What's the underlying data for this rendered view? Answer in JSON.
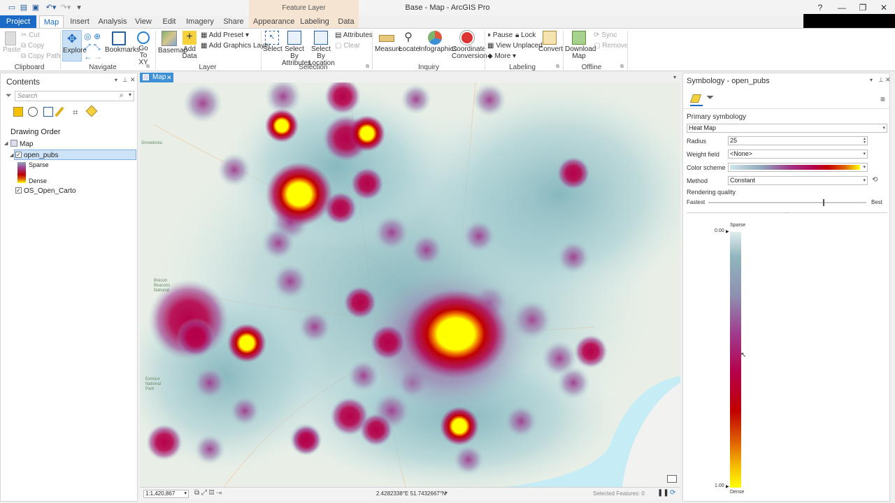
{
  "window": {
    "title": "Base - Map - ArcGIS Pro"
  },
  "context_tab": {
    "label": "Feature Layer"
  },
  "tabs": [
    {
      "label": "Project"
    },
    {
      "label": "Map"
    },
    {
      "label": "Insert"
    },
    {
      "label": "Analysis"
    },
    {
      "label": "View"
    },
    {
      "label": "Edit"
    },
    {
      "label": "Imagery"
    },
    {
      "label": "Share"
    },
    {
      "label": "Appearance"
    },
    {
      "label": "Labeling"
    },
    {
      "label": "Data"
    }
  ],
  "ribbon": {
    "clipboard": {
      "paste": "Paste",
      "cut": "Cut",
      "copy": "Copy",
      "copy_path": "Copy Path",
      "group": "Clipboard"
    },
    "navigate": {
      "explore": "Explore",
      "bookmarks": "Bookmarks",
      "goto": "Go",
      "goto2": "To XY",
      "group": "Navigate"
    },
    "layer": {
      "basemap": "Basemap",
      "add_data": "Add",
      "add_data2": "Data",
      "add_preset": "Add Preset",
      "add_graphics": "Add Graphics Layer",
      "group": "Layer"
    },
    "selection": {
      "select": "Select",
      "by_attr": "Select By",
      "by_attr2": "Attributes",
      "by_loc": "Select By",
      "by_loc2": "Location",
      "attributes": "Attributes",
      "clear": "Clear",
      "group": "Selection"
    },
    "inquiry": {
      "measure": "Measure",
      "locate": "Locate",
      "infographics": "Infographics",
      "coord": "Coordinate",
      "coord2": "Conversion",
      "group": "Inquiry"
    },
    "labeling": {
      "pause": "Pause",
      "lock": "Lock",
      "view_unplaced": "View Unplaced",
      "more": "More",
      "convert": "Convert",
      "group": "Labeling"
    },
    "offline": {
      "download": "Download",
      "download2": "Map",
      "sync": "Sync",
      "remove": "Remove",
      "group": "Offline"
    }
  },
  "contents": {
    "title": "Contents",
    "search_placeholder": "Search",
    "drawing_order": "Drawing Order",
    "map_label": "Map",
    "layer1": "open_pubs",
    "sparse": "Sparse",
    "dense": "Dense",
    "layer2": "OS_Open_Carto"
  },
  "map_view": {
    "tab_label": "Map",
    "scale": "1:1,420,867",
    "coords": "2.4282338°E 51.7432667°N",
    "selected_features": "Selected Features: 0",
    "place_labels": [
      "National",
      "Park",
      "Brecon",
      "Beacons",
      "Exmoor",
      "Snowdonia"
    ]
  },
  "symbology": {
    "title": "Symbology - open_pubs",
    "primary": "Primary symbology",
    "type": "Heat Map",
    "radius_label": "Radius",
    "radius_value": "25",
    "weight_label": "Weight field",
    "weight_value": "<None>",
    "color_scheme_label": "Color scheme",
    "method_label": "Method",
    "method_value": "Constant",
    "quality_label": "Rendering quality",
    "fastest": "Fastest",
    "best": "Best",
    "quality_level": 0.73,
    "ramp_top_label": "Sparse",
    "ramp_top_value": "0.00",
    "ramp_bottom_value": "1.00",
    "ramp_bottom_label": "Dense"
  },
  "colors": {
    "accent": "#1b6ac6",
    "ramp": [
      "#bfe3e8",
      "#7fb3bb",
      "#8f6fa0",
      "#a03a8c",
      "#b5004a",
      "#c00000",
      "#e06000",
      "#f5c000",
      "#ffff00"
    ]
  }
}
